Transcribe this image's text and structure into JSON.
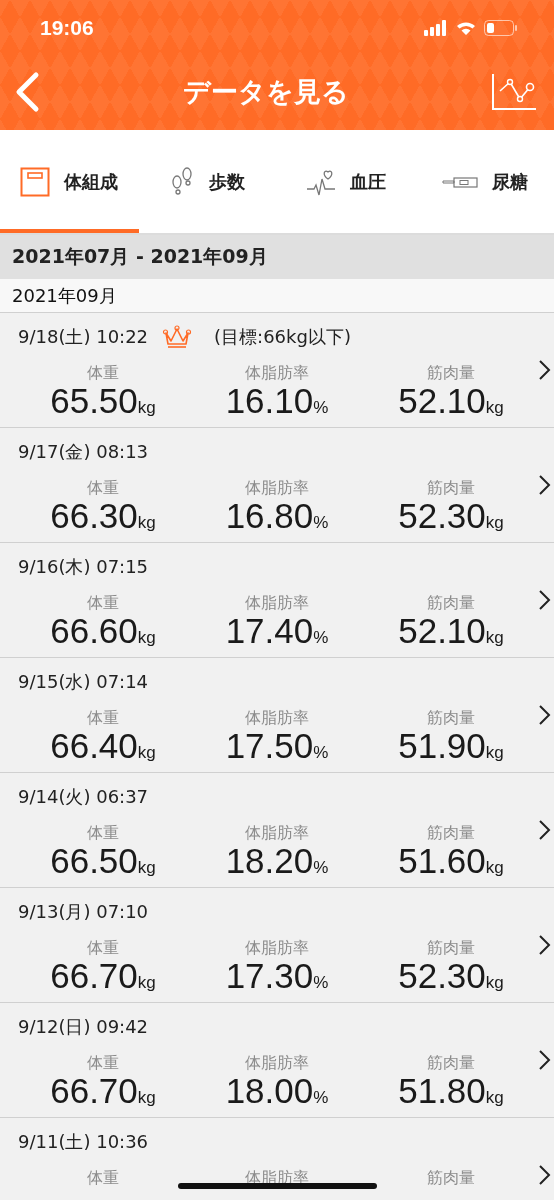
{
  "status_bar": {
    "time": "19:06"
  },
  "nav": {
    "title": "データを見る"
  },
  "tabs": [
    {
      "label": "体組成",
      "selected": true,
      "kind": "scale"
    },
    {
      "label": "歩数",
      "selected": false,
      "kind": "steps"
    },
    {
      "label": "血圧",
      "selected": false,
      "kind": "pulse"
    },
    {
      "label": "尿糖",
      "selected": false,
      "kind": "strip"
    }
  ],
  "range": "2021年07月 - 2021年09月",
  "month": "2021年09月",
  "records": [
    {
      "datetime": "9/18(土) 10:22",
      "crown": true,
      "goal": "(目標:66kg以下)",
      "metrics": [
        {
          "label": "体重",
          "value": "65.50",
          "unit": "kg"
        },
        {
          "label": "体脂肪率",
          "value": "16.10",
          "unit": "%"
        },
        {
          "label": "筋肉量",
          "value": "52.10",
          "unit": "kg"
        }
      ]
    },
    {
      "datetime": "9/17(金) 08:13",
      "crown": false,
      "metrics": [
        {
          "label": "体重",
          "value": "66.30",
          "unit": "kg"
        },
        {
          "label": "体脂肪率",
          "value": "16.80",
          "unit": "%"
        },
        {
          "label": "筋肉量",
          "value": "52.30",
          "unit": "kg"
        }
      ]
    },
    {
      "datetime": "9/16(木) 07:15",
      "crown": false,
      "metrics": [
        {
          "label": "体重",
          "value": "66.60",
          "unit": "kg"
        },
        {
          "label": "体脂肪率",
          "value": "17.40",
          "unit": "%"
        },
        {
          "label": "筋肉量",
          "value": "52.10",
          "unit": "kg"
        }
      ]
    },
    {
      "datetime": "9/15(水) 07:14",
      "crown": false,
      "metrics": [
        {
          "label": "体重",
          "value": "66.40",
          "unit": "kg"
        },
        {
          "label": "体脂肪率",
          "value": "17.50",
          "unit": "%"
        },
        {
          "label": "筋肉量",
          "value": "51.90",
          "unit": "kg"
        }
      ]
    },
    {
      "datetime": "9/14(火) 06:37",
      "crown": false,
      "metrics": [
        {
          "label": "体重",
          "value": "66.50",
          "unit": "kg"
        },
        {
          "label": "体脂肪率",
          "value": "18.20",
          "unit": "%"
        },
        {
          "label": "筋肉量",
          "value": "51.60",
          "unit": "kg"
        }
      ]
    },
    {
      "datetime": "9/13(月) 07:10",
      "crown": false,
      "metrics": [
        {
          "label": "体重",
          "value": "66.70",
          "unit": "kg"
        },
        {
          "label": "体脂肪率",
          "value": "17.30",
          "unit": "%"
        },
        {
          "label": "筋肉量",
          "value": "52.30",
          "unit": "kg"
        }
      ]
    },
    {
      "datetime": "9/12(日) 09:42",
      "crown": false,
      "metrics": [
        {
          "label": "体重",
          "value": "66.70",
          "unit": "kg"
        },
        {
          "label": "体脂肪率",
          "value": "18.00",
          "unit": "%"
        },
        {
          "label": "筋肉量",
          "value": "51.80",
          "unit": "kg"
        }
      ]
    },
    {
      "datetime": "9/11(土) 10:36",
      "crown": false,
      "metrics": [
        {
          "label": "体重"
        },
        {
          "label": "体脂肪率"
        },
        {
          "label": "筋肉量"
        }
      ]
    }
  ]
}
